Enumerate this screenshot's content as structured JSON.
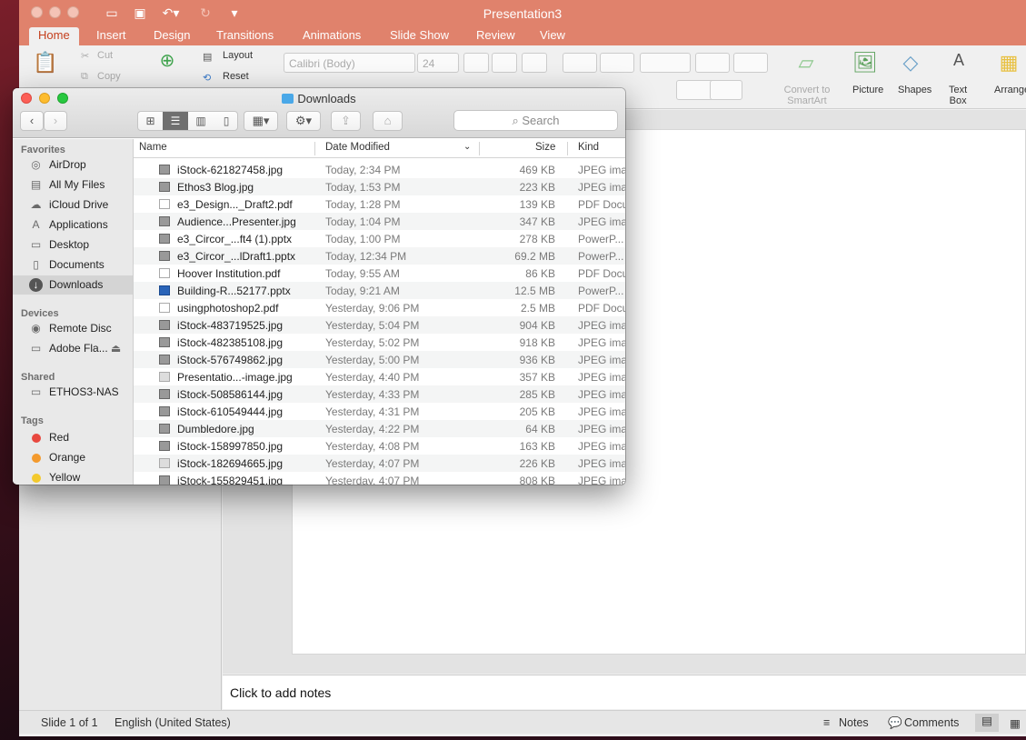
{
  "ppt": {
    "title": "Presentation3",
    "tabs": [
      "Home",
      "Insert",
      "Design",
      "Transitions",
      "Animations",
      "Slide Show",
      "Review",
      "View"
    ],
    "ribbon": {
      "cut": "Cut",
      "copy": "Copy",
      "layout": "Layout",
      "reset": "Reset",
      "font_name": "Calibri (Body)",
      "font_size": "24",
      "convert_smartart": "Convert to\nSmartArt",
      "picture": "Picture",
      "shapes": "Shapes",
      "text_box": "Text\nBox",
      "arrange": "Arrange"
    },
    "notes_placeholder": "Click to add notes",
    "status": {
      "slide": "Slide 1 of 1",
      "language": "English (United States)",
      "notes": "Notes",
      "comments": "Comments"
    }
  },
  "finder": {
    "title": "Downloads",
    "search_placeholder": "Search",
    "sidebar": {
      "favorites_label": "Favorites",
      "favorites": [
        {
          "label": "AirDrop",
          "icon": "airdrop-icon"
        },
        {
          "label": "All My Files",
          "icon": "all-files-icon"
        },
        {
          "label": "iCloud Drive",
          "icon": "cloud-icon"
        },
        {
          "label": "Applications",
          "icon": "applications-icon"
        },
        {
          "label": "Desktop",
          "icon": "desktop-icon"
        },
        {
          "label": "Documents",
          "icon": "documents-icon"
        },
        {
          "label": "Downloads",
          "icon": "downloads-icon"
        }
      ],
      "devices_label": "Devices",
      "devices": [
        {
          "label": "Remote Disc",
          "icon": "disc-icon"
        },
        {
          "label": "Adobe Fla...",
          "icon": "drive-icon"
        }
      ],
      "shared_label": "Shared",
      "shared": [
        {
          "label": "ETHOS3-NAS",
          "icon": "network-icon"
        }
      ],
      "tags_label": "Tags",
      "tags": [
        {
          "label": "Red",
          "color": "#e8483f"
        },
        {
          "label": "Orange",
          "color": "#f39a2d"
        },
        {
          "label": "Yellow",
          "color": "#f3c92d"
        }
      ]
    },
    "columns": {
      "name": "Name",
      "date": "Date Modified",
      "size": "Size",
      "kind": "Kind"
    },
    "files": [
      {
        "name": "iStock-621827458.jpg",
        "date": "Today, 2:34 PM",
        "size": "469 KB",
        "kind": "JPEG ima",
        "icon": "image"
      },
      {
        "name": "Ethos3 Blog.jpg",
        "date": "Today, 1:53 PM",
        "size": "223 KB",
        "kind": "JPEG ima",
        "icon": "image"
      },
      {
        "name": "e3_Design..._Draft2.pdf",
        "date": "Today, 1:28 PM",
        "size": "139 KB",
        "kind": "PDF Docu",
        "icon": "pdf"
      },
      {
        "name": "Audience...Presenter.jpg",
        "date": "Today, 1:04 PM",
        "size": "347 KB",
        "kind": "JPEG ima",
        "icon": "image"
      },
      {
        "name": "e3_Circor_...ft4 (1).pptx",
        "date": "Today, 1:00 PM",
        "size": "278 KB",
        "kind": "PowerP...",
        "icon": "image"
      },
      {
        "name": "e3_Circor_...lDraft1.pptx",
        "date": "Today, 12:34 PM",
        "size": "69.2 MB",
        "kind": "PowerP...",
        "icon": "image"
      },
      {
        "name": "Hoover Institution.pdf",
        "date": "Today, 9:55 AM",
        "size": "86 KB",
        "kind": "PDF Docu",
        "icon": "pdf"
      },
      {
        "name": "Building-R...52177.pptx",
        "date": "Today, 9:21 AM",
        "size": "12.5 MB",
        "kind": "PowerP...",
        "icon": "blue"
      },
      {
        "name": "usingphotoshop2.pdf",
        "date": "Yesterday, 9:06 PM",
        "size": "2.5 MB",
        "kind": "PDF Docu",
        "icon": "pdf"
      },
      {
        "name": "iStock-483719525.jpg",
        "date": "Yesterday, 5:04 PM",
        "size": "904 KB",
        "kind": "JPEG ima",
        "icon": "image"
      },
      {
        "name": "iStock-482385108.jpg",
        "date": "Yesterday, 5:02 PM",
        "size": "918 KB",
        "kind": "JPEG ima",
        "icon": "image"
      },
      {
        "name": "iStock-576749862.jpg",
        "date": "Yesterday, 5:00 PM",
        "size": "936 KB",
        "kind": "JPEG ima",
        "icon": "image"
      },
      {
        "name": "Presentatio...-image.jpg",
        "date": "Yesterday, 4:40 PM",
        "size": "357 KB",
        "kind": "JPEG ima",
        "icon": "light"
      },
      {
        "name": "iStock-508586144.jpg",
        "date": "Yesterday, 4:33 PM",
        "size": "285 KB",
        "kind": "JPEG ima",
        "icon": "image"
      },
      {
        "name": "iStock-610549444.jpg",
        "date": "Yesterday, 4:31 PM",
        "size": "205 KB",
        "kind": "JPEG ima",
        "icon": "image"
      },
      {
        "name": "Dumbledore.jpg",
        "date": "Yesterday, 4:22 PM",
        "size": "64 KB",
        "kind": "JPEG ima",
        "icon": "image"
      },
      {
        "name": "iStock-158997850.jpg",
        "date": "Yesterday, 4:08 PM",
        "size": "163 KB",
        "kind": "JPEG ima",
        "icon": "image"
      },
      {
        "name": "iStock-182694665.jpg",
        "date": "Yesterday, 4:07 PM",
        "size": "226 KB",
        "kind": "JPEG ima",
        "icon": "light"
      },
      {
        "name": "iStock-155829451.jpg",
        "date": "Yesterday, 4:07 PM",
        "size": "808 KB",
        "kind": "JPEG ima",
        "icon": "image"
      }
    ]
  }
}
